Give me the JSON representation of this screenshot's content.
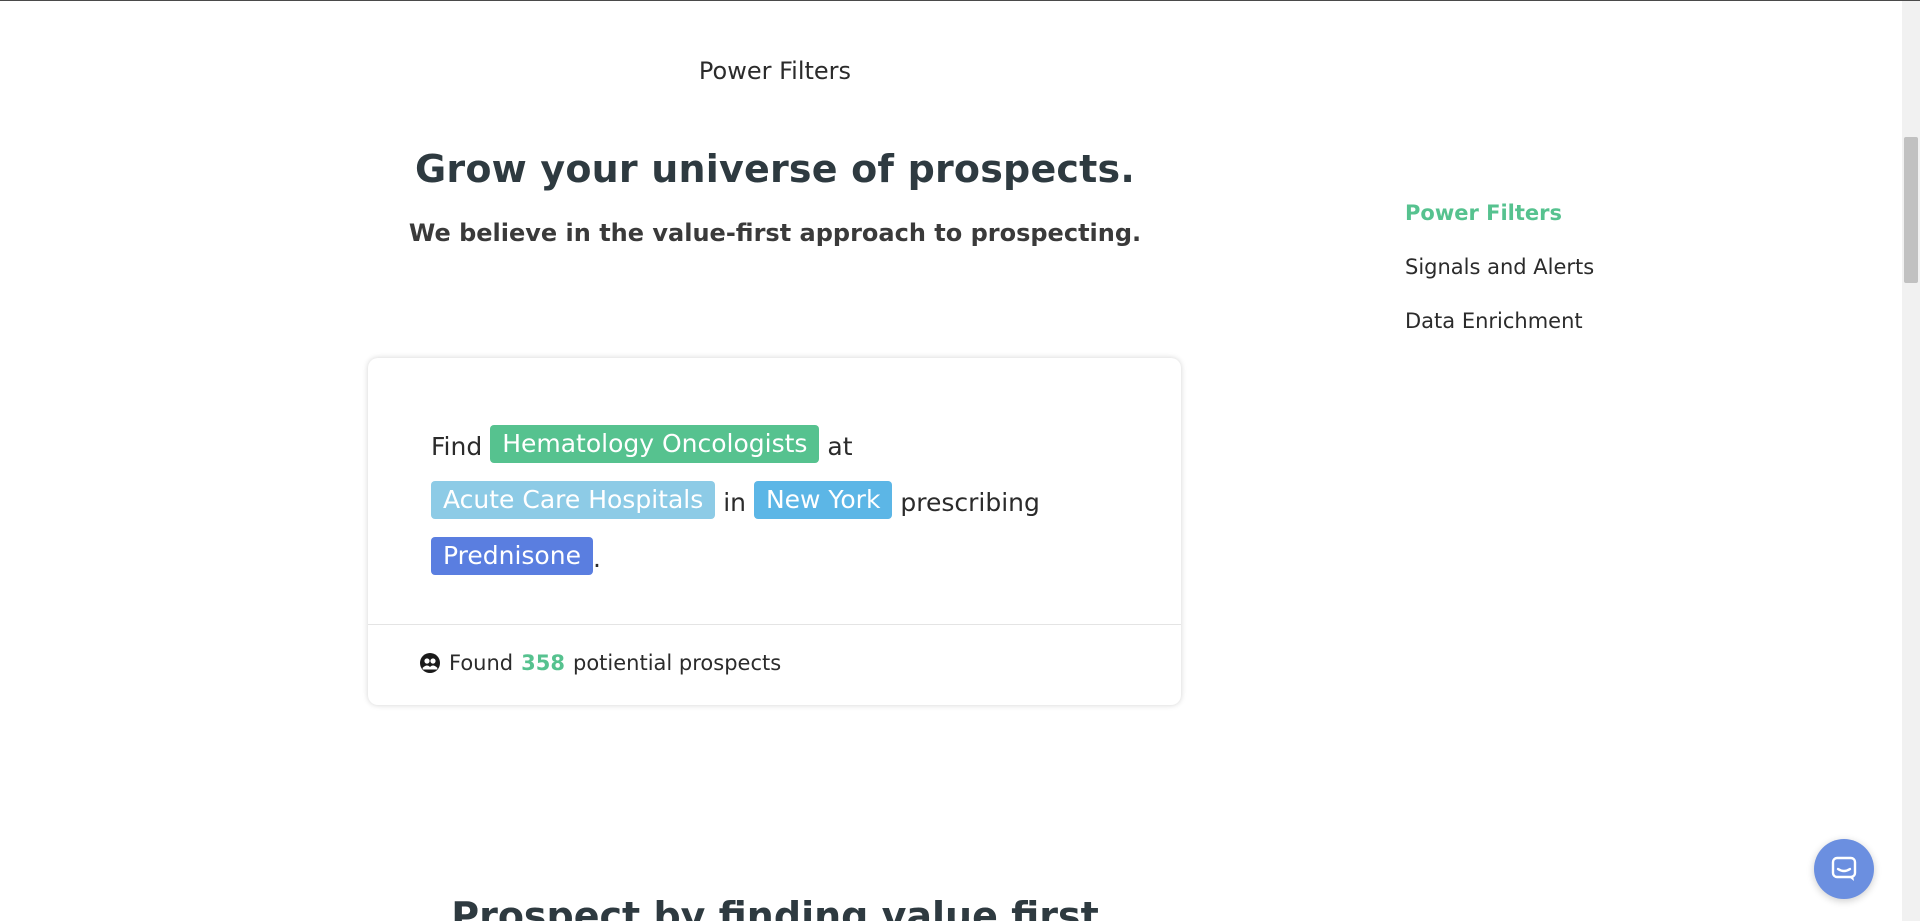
{
  "section_label": "Power Filters",
  "headline": "Grow your universe of prospects.",
  "subheadline": "We believe in the value-first approach to prospecting.",
  "side_nav": {
    "items": [
      {
        "label": "Power Filters",
        "active": true
      },
      {
        "label": "Signals and Alerts",
        "active": false
      },
      {
        "label": "Data Enrichment",
        "active": false
      }
    ]
  },
  "card": {
    "line1": {
      "prefix": "Find",
      "chip": "Hematology Oncologists",
      "suffix": "at"
    },
    "line2": {
      "chip1": "Acute Care Hospitals",
      "mid": "in",
      "chip2": "New York",
      "suffix": "prescribing"
    },
    "line3": {
      "chip": "Prednisone",
      "suffix": "."
    },
    "footer": {
      "prefix": "Found",
      "count": "358",
      "suffix": "potiential prospects",
      "icon": "people-icon"
    }
  },
  "next_heading": "Prospect by finding value first",
  "chat": {
    "icon": "chat-icon"
  },
  "colors": {
    "accent_green": "#56c28f",
    "chip_light_blue": "#8dcbe6",
    "chip_blue": "#5cb6e6",
    "chip_indigo": "#5a7ee0",
    "chat_bg": "#6b8fe0"
  }
}
